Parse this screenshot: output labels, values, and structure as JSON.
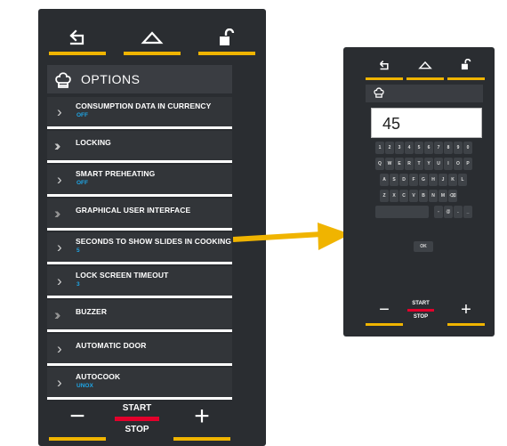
{
  "colors": {
    "accent": "#f0b400",
    "start_stop": "#e3002b",
    "value": "#1ea5e5",
    "panel": "#2a2d31"
  },
  "left": {
    "nav": {
      "back_icon": "back-arrow-icon",
      "home_icon": "home-icon",
      "lock_icon": "unlock-icon"
    },
    "title": "OPTIONS",
    "title_icon": "chef-hat-icon",
    "items": [
      {
        "label": "CONSUMPTION DATA IN CURRENCY",
        "value": "OFF",
        "chevron": "single"
      },
      {
        "label": "LOCKING",
        "value": "",
        "chevron": "double"
      },
      {
        "label": "SMART PREHEATING",
        "value": "OFF",
        "chevron": "single"
      },
      {
        "label": "GRAPHICAL USER INTERFACE",
        "value": "",
        "chevron": "double-selected"
      },
      {
        "label": "SECONDS TO SHOW SLIDES IN COOKING",
        "value": "5",
        "chevron": "single"
      },
      {
        "label": "LOCK SCREEN TIMEOUT",
        "value": "3",
        "chevron": "single"
      },
      {
        "label": "BUZZER",
        "value": "",
        "chevron": "double-selected"
      },
      {
        "label": "AUTOMATIC DOOR",
        "value": "",
        "chevron": "single"
      },
      {
        "label": "AUTOCOOK",
        "value": "UNOX",
        "chevron": "single"
      }
    ],
    "bottom": {
      "minus": "−",
      "plus": "+",
      "start": "START",
      "stop": "STOP"
    }
  },
  "right": {
    "title_icon": "chef-hat-icon",
    "input_value": "45",
    "keys": {
      "row1": [
        "1",
        "2",
        "3",
        "4",
        "5",
        "6",
        "7",
        "8",
        "9",
        "0"
      ],
      "row2": [
        "Q",
        "W",
        "E",
        "R",
        "T",
        "Y",
        "U",
        "I",
        "O",
        "P"
      ],
      "row3": [
        "A",
        "S",
        "D",
        "F",
        "G",
        "H",
        "J",
        "K",
        "L"
      ],
      "row4": [
        "Z",
        "X",
        "C",
        "V",
        "B",
        "N",
        "M",
        "⌫"
      ],
      "row5": [
        "-",
        "@",
        ".",
        "_"
      ]
    },
    "ok": "OK",
    "bottom": {
      "minus": "−",
      "plus": "+",
      "start": "START",
      "stop": "STOP"
    }
  }
}
